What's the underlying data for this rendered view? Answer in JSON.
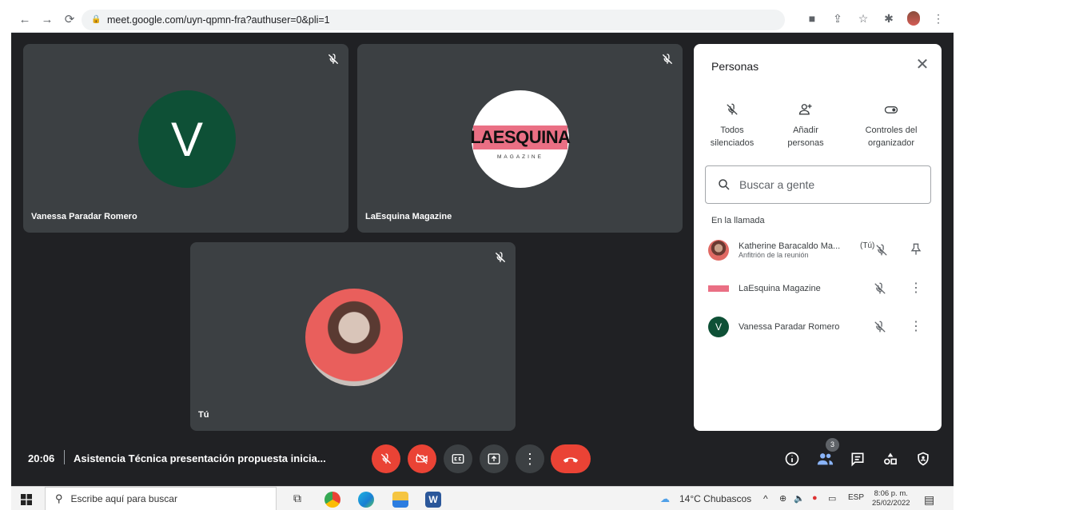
{
  "browser": {
    "url": "meet.google.com/uyn-qpmn-fra?authuser=0&pli=1"
  },
  "tiles": [
    {
      "name": "Vanessa Paradar Romero",
      "initial": "V"
    },
    {
      "name": "LaEsquina Magazine",
      "logo_main": "LAESQUINA",
      "logo_sub": "MAGAZINE"
    },
    {
      "name": "Tú"
    }
  ],
  "panel": {
    "title": "Personas",
    "actions": [
      {
        "label_line1": "Todos",
        "label_line2": "silenciados",
        "icon": "mic-off-icon"
      },
      {
        "label_line1": "Añadir",
        "label_line2": "personas",
        "icon": "add-person-icon"
      },
      {
        "label_line1": "Controles del",
        "label_line2": "organizador",
        "icon": "toggle-icon"
      }
    ],
    "search_placeholder": "Buscar a gente",
    "section_label": "En la llamada",
    "people": [
      {
        "name": "Katherine Baracaldo Ma...",
        "subtitle": "Anfitrión de la reunión",
        "you_tag": "(Tú)",
        "action_icon": "pin-icon"
      },
      {
        "name": "LaEsquina Magazine",
        "subtitle": "",
        "you_tag": "",
        "action_icon": "more-vert-icon"
      },
      {
        "name": "Vanessa Paradar Romero",
        "initial": "V",
        "subtitle": "",
        "you_tag": "",
        "action_icon": "more-vert-icon"
      }
    ]
  },
  "meeting": {
    "time": "20:06",
    "title": "Asistencia Técnica presentación propuesta inicia...",
    "participant_count": "3"
  },
  "taskbar": {
    "search_placeholder": "Escribe aquí para buscar",
    "weather": "14°C  Chubascos",
    "language": "ESP",
    "clock_time": "8:06 p. m.",
    "clock_date": "25/02/2022"
  },
  "colors": {
    "meet_bg": "#202124",
    "tile_bg": "#3c4043",
    "danger_red": "#ea4335",
    "avatar_green": "#0e5036",
    "logo_pink": "#ea6f84"
  }
}
